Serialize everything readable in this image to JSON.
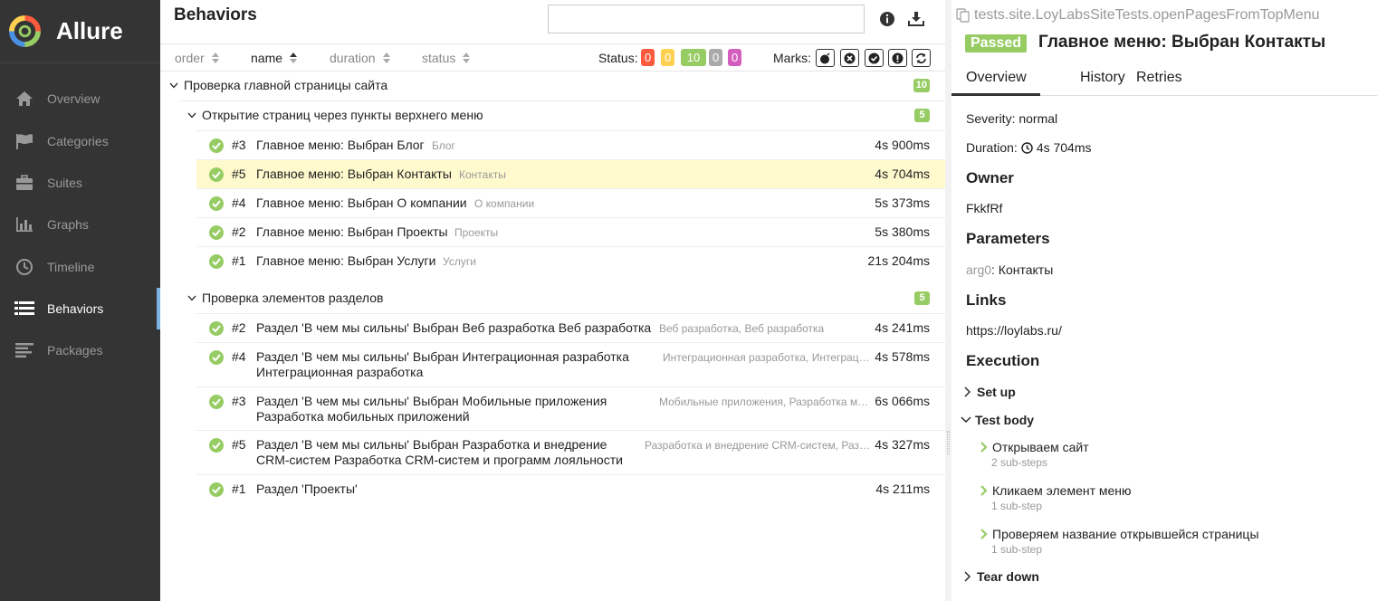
{
  "app": {
    "name": "Allure"
  },
  "sidebar": {
    "items": [
      {
        "label": "Overview",
        "icon": "home-icon"
      },
      {
        "label": "Categories",
        "icon": "flag-icon"
      },
      {
        "label": "Suites",
        "icon": "briefcase-icon"
      },
      {
        "label": "Graphs",
        "icon": "bar-chart-icon"
      },
      {
        "label": "Timeline",
        "icon": "clock-icon"
      },
      {
        "label": "Behaviors",
        "icon": "list-icon",
        "active": true
      },
      {
        "label": "Packages",
        "icon": "align-left-icon"
      }
    ]
  },
  "behaviors": {
    "title": "Behaviors",
    "search_value": "",
    "sort": {
      "order": "order",
      "name": "name",
      "duration": "duration",
      "status": "status"
    },
    "status_label": "Status:",
    "status_counts": [
      "0",
      "0",
      "10",
      "0",
      "0"
    ],
    "status_colors": [
      "#fd5a3e",
      "#ffd050",
      "#97cc64",
      "#aaaaaa",
      "#d35ebe"
    ],
    "marks_label": "Marks:",
    "epic": {
      "label": "Проверка главной страницы сайта",
      "count": "10"
    },
    "groups": [
      {
        "label": "Открытие страниц через пункты верхнего меню",
        "count": "5",
        "tests": [
          {
            "num": "#3",
            "name": "Главное меню: Выбран Блог",
            "tag": "Блог",
            "duration": "4s 900ms"
          },
          {
            "num": "#5",
            "name": "Главное меню: Выбран Контакты",
            "tag": "Контакты",
            "duration": "4s 704ms",
            "selected": true
          },
          {
            "num": "#4",
            "name": "Главное меню: Выбран О компании",
            "tag": "О компании",
            "duration": "5s 373ms"
          },
          {
            "num": "#2",
            "name": "Главное меню: Выбран Проекты",
            "tag": "Проекты",
            "duration": "5s 380ms"
          },
          {
            "num": "#1",
            "name": "Главное меню: Выбран Услуги",
            "tag": "Услуги",
            "duration": "21s 204ms"
          }
        ]
      },
      {
        "label": "Проверка элементов разделов",
        "count": "5",
        "tests": [
          {
            "num": "#2",
            "name": "Раздел 'В чем мы сильны' Выбран Веб разработка Веб разработка",
            "tag": "Веб разработка, Веб разработка",
            "duration": "4s 241ms"
          },
          {
            "num": "#4",
            "name_line1": "Раздел 'В чем мы сильны' Выбран Интеграционная разработка",
            "name_line2": "Интеграционная разработка",
            "tag": "Интеграционная разработка, Интеграционная разработка",
            "duration": "4s 578ms"
          },
          {
            "num": "#3",
            "name_line1": "Раздел 'В чем мы сильны' Выбран Мобильные приложения",
            "name_line2": "Разработка мобильных приложений",
            "tag": "Мобильные приложения, Разработка мобильных приложений",
            "duration": "6s 066ms"
          },
          {
            "num": "#5",
            "name_line1": "Раздел 'В чем мы сильны' Выбран Разработка и внедрение",
            "name_line2": "CRM-систем Разработка CRM-систем и программ лояльности",
            "tag": "Разработка и внедрение CRM-систем, Разработка CRM-систем и программ лояльности",
            "duration": "4s 327ms"
          },
          {
            "num": "#1",
            "name": "Раздел 'Проекты'",
            "tag": "",
            "duration": "4s 211ms"
          }
        ]
      }
    ]
  },
  "details": {
    "full_name": "tests.site.LoyLabsSiteTests.openPagesFromTopMenu",
    "status": "Passed",
    "title": "Главное меню: Выбран Контакты",
    "tabs": [
      "Overview",
      "History",
      "Retries"
    ],
    "severity": "Severity: normal",
    "duration_label": "Duration:",
    "duration": "4s 704ms",
    "owner_heading": "Owner",
    "owner": "FkkfRf",
    "parameters_heading": "Parameters",
    "param_name": "arg0",
    "param_value": ": Контакты",
    "links_heading": "Links",
    "link": "https://loylabs.ru/",
    "execution_heading": "Execution",
    "setup": "Set up",
    "test_body": "Test body",
    "steps": [
      {
        "title": "Открываем сайт",
        "sub": "2 sub-steps"
      },
      {
        "title": "Кликаем элемент меню",
        "sub": "1 sub-step"
      },
      {
        "title": "Проверяем название открывшейся страницы",
        "sub": "1 sub-step"
      }
    ],
    "teardown": "Tear down"
  }
}
